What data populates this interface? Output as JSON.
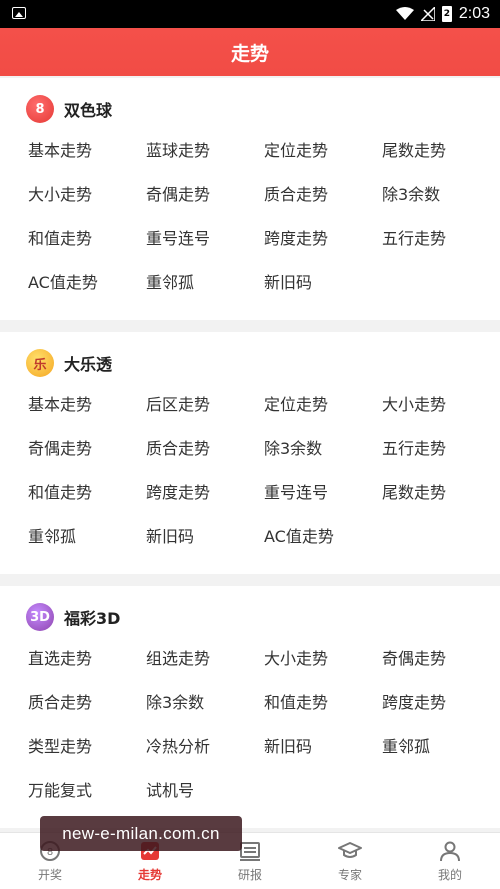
{
  "status_bar": {
    "time": "2:03",
    "battery_glyph": "2"
  },
  "app_bar": {
    "title": "走势"
  },
  "sections": [
    {
      "title": "双色球",
      "logo_icon": "shuangseqiu-logo-icon",
      "logo_text": "8",
      "items": [
        "基本走势",
        "蓝球走势",
        "定位走势",
        "尾数走势",
        "大小走势",
        "奇偶走势",
        "质合走势",
        "除3余数",
        "和值走势",
        "重号连号",
        "跨度走势",
        "五行走势",
        "AC值走势",
        "重邻孤",
        "新旧码"
      ]
    },
    {
      "title": "大乐透",
      "logo_icon": "daletou-logo-icon",
      "logo_text": "乐",
      "items": [
        "基本走势",
        "后区走势",
        "定位走势",
        "大小走势",
        "奇偶走势",
        "质合走势",
        "除3余数",
        "五行走势",
        "和值走势",
        "跨度走势",
        "重号连号",
        "尾数走势",
        "重邻孤",
        "新旧码",
        "AC值走势"
      ]
    },
    {
      "title": "福彩3D",
      "logo_icon": "fucai3d-logo-icon",
      "logo_text": "3D",
      "items": [
        "直选走势",
        "组选走势",
        "大小走势",
        "奇偶走势",
        "质合走势",
        "除3余数",
        "和值走势",
        "跨度走势",
        "类型走势",
        "冷热分析",
        "新旧码",
        "重邻孤",
        "万能复式",
        "试机号"
      ]
    }
  ],
  "bottom_nav": [
    {
      "label": "开奖",
      "icon": "lottery-ball-icon",
      "active": false
    },
    {
      "label": "走势",
      "icon": "trend-chart-icon",
      "active": true
    },
    {
      "label": "研报",
      "icon": "report-icon",
      "active": false
    },
    {
      "label": "专家",
      "icon": "graduation-cap-icon",
      "active": false
    },
    {
      "label": "我的",
      "icon": "user-icon",
      "active": false
    }
  ],
  "watermark": {
    "text": "new-e-milan.com.cn"
  },
  "colors": {
    "accent": "#f14c45",
    "active_tab": "#e53935"
  }
}
